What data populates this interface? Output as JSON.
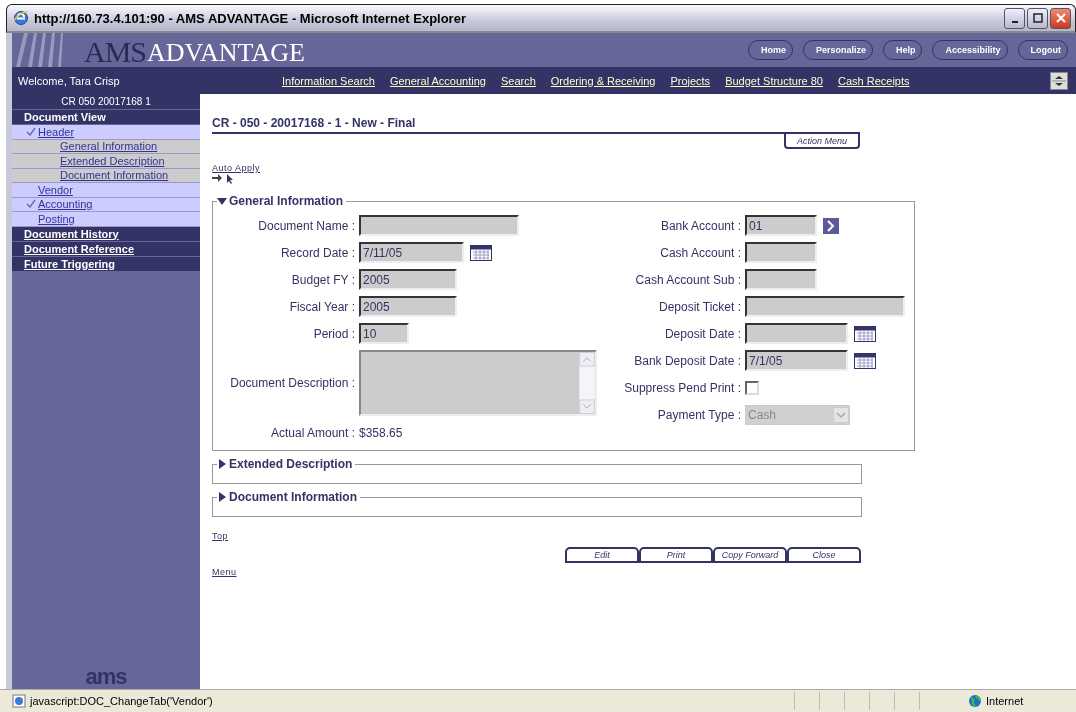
{
  "window": {
    "title": "http://160.73.4.101:90 - AMS ADVANTAGE - Microsoft Internet Explorer"
  },
  "banner": {
    "logo_faded": "AMS",
    "logo_main": "ADVANTAGE",
    "buttons": [
      "Home",
      "Personalize",
      "Help",
      "Accessibility",
      "Logout"
    ]
  },
  "nav": {
    "welcome": "Welcome, Tara Crisp",
    "links": [
      "Information Search",
      "General Accounting",
      "Search",
      "Ordering & Receiving",
      "Projects",
      "Budget Structure 80",
      "Cash Receipts"
    ]
  },
  "sidebar": {
    "document_id": "CR 050 20017168 1",
    "footer_logo": "ams",
    "sections": [
      {
        "label": "Document View",
        "children": [
          {
            "label": "Header",
            "checked": true,
            "children": [
              {
                "label": "General Information",
                "checked": false
              },
              {
                "label": "Extended Description",
                "checked": false
              },
              {
                "label": "Document Information",
                "checked": false
              }
            ]
          },
          {
            "label": "Vendor",
            "checked": false
          },
          {
            "label": "Accounting",
            "checked": true
          },
          {
            "label": "Posting",
            "checked": false
          }
        ]
      },
      {
        "label": "Document History"
      },
      {
        "label": "Document Reference"
      },
      {
        "label": "Future Triggering"
      }
    ]
  },
  "document": {
    "title": "CR - 050 - 20017168 - 1 - New - Final",
    "action_menu": "Action Menu",
    "auto_apply": "Auto Apply",
    "sections": [
      {
        "title": "General Information",
        "expanded": true,
        "left_fields": [
          {
            "label": "Document Name :",
            "kind": "text"
          },
          {
            "label": "Record Date :",
            "kind": "date",
            "value": "7/11/05"
          },
          {
            "label": "Budget FY :",
            "kind": "text",
            "value": "2005"
          },
          {
            "label": "Fiscal Year :",
            "kind": "text",
            "value": "2005"
          },
          {
            "label": "Period :",
            "kind": "text",
            "value": "10"
          },
          {
            "label": "Document Description :",
            "kind": "textarea"
          },
          {
            "label": "Actual Amount :",
            "kind": "display",
            "value": "$358.65"
          }
        ],
        "right_fields": [
          {
            "label": "Bank Account :",
            "kind": "lookup",
            "value": "01"
          },
          {
            "label": "Cash Account :",
            "kind": "text"
          },
          {
            "label": "Cash Account Sub :",
            "kind": "text"
          },
          {
            "label": "Deposit Ticket :",
            "kind": "text"
          },
          {
            "label": "Deposit Date :",
            "kind": "date"
          },
          {
            "label": "Bank Deposit Date :",
            "kind": "date",
            "value": "7/1/05"
          },
          {
            "label": "Suppress Pend Print :",
            "kind": "checkbox",
            "checked": false
          },
          {
            "label": "Payment Type :",
            "kind": "select",
            "value": "Cash",
            "disabled": true
          }
        ]
      },
      {
        "title": "Extended Description",
        "expanded": false
      },
      {
        "title": "Document Information",
        "expanded": false
      }
    ],
    "top_link": "Top",
    "buttons": [
      "Edit",
      "Print",
      "Copy Forward",
      "Close"
    ],
    "menu_link": "Menu"
  },
  "status_bar": {
    "text": "javascript:DOC_ChangeTab('Vendor')",
    "zone": "Internet"
  }
}
